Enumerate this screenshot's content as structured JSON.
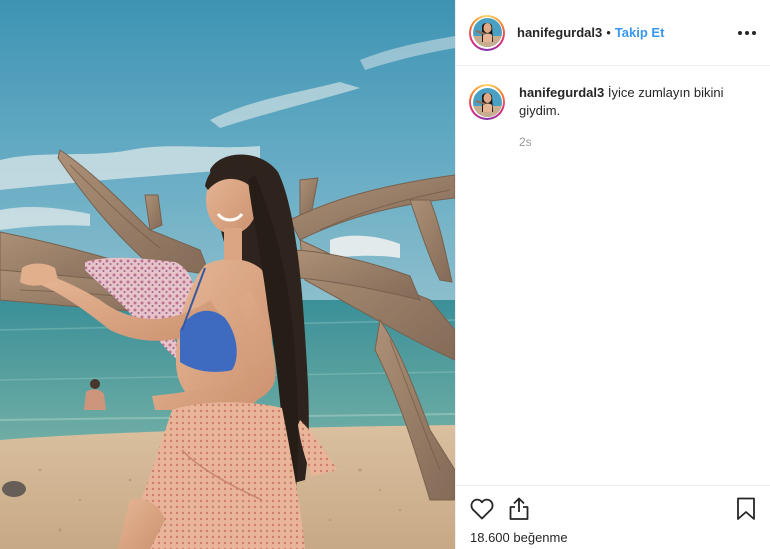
{
  "post": {
    "username": "hanifegurdal3",
    "separator": "•",
    "follow_label": "Takip Et",
    "more_icon": "more-horizontal-icon",
    "caption": {
      "username": "hanifegurdal3",
      "text": "İyice zumlayın bikini giydim."
    },
    "time_ago": "2s",
    "likes_count": "18.600",
    "likes_label": "beğenme",
    "icons": {
      "like": "heart-outline-icon",
      "share": "share-icon",
      "save": "bookmark-icon"
    },
    "colors": {
      "link_blue": "#3897f0",
      "text": "#262626",
      "muted": "#999999",
      "sky": "#3a93b8",
      "sea": "#2f8f9a",
      "sand": "#cdb193",
      "bikini": "#2f63c4"
    }
  }
}
